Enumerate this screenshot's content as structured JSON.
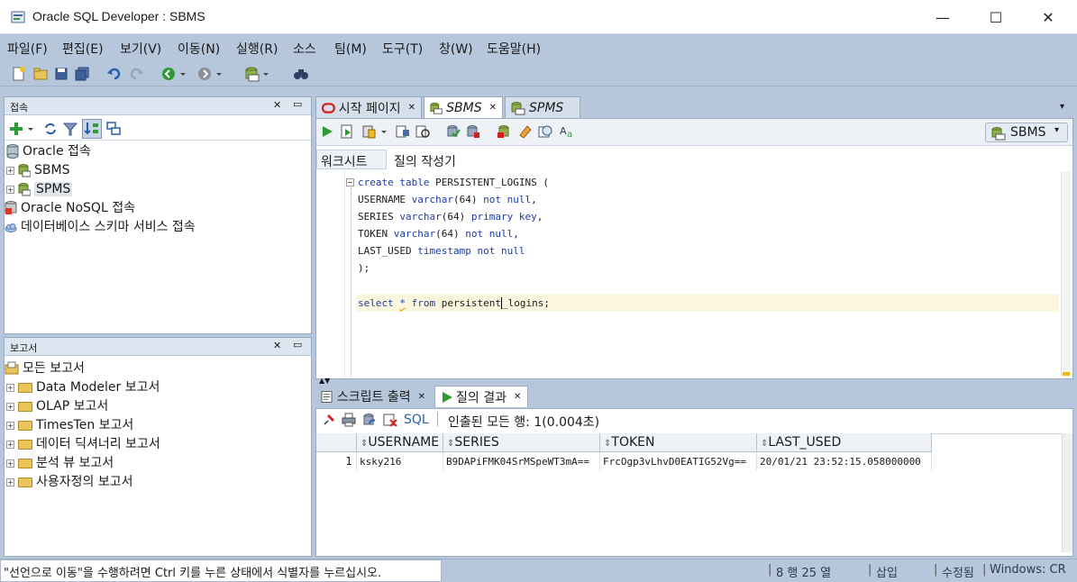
{
  "window": {
    "title": "Oracle SQL Developer : SBMS",
    "minimize": "—",
    "maximize": "☐",
    "close": "✕"
  },
  "menu": [
    "파일(F)",
    "편집(E)",
    "보기(V)",
    "이동(N)",
    "실행(R)",
    "소스",
    "팀(M)",
    "도구(T)",
    "창(W)",
    "도움말(H)"
  ],
  "connections_panel": {
    "title": "접속",
    "items": [
      {
        "label": "Oracle 접속"
      },
      {
        "label": "SBMS"
      },
      {
        "label": "SPMS"
      },
      {
        "label": "Oracle NoSQL 접속"
      },
      {
        "label": "데이터베이스 스키마 서비스 접속"
      }
    ]
  },
  "reports_panel": {
    "title": "보고서",
    "items": [
      {
        "label": "모든 보고서"
      },
      {
        "label": "Data Modeler 보고서"
      },
      {
        "label": "OLAP 보고서"
      },
      {
        "label": "TimesTen 보고서"
      },
      {
        "label": "데이터 딕셔너리 보고서"
      },
      {
        "label": "분석 뷰 보고서"
      },
      {
        "label": "사용자정의 보고서"
      }
    ]
  },
  "editor_tabs": [
    {
      "label": "시작 페이지"
    },
    {
      "label": "SBMS"
    },
    {
      "label": "SPMS"
    }
  ],
  "connection_selector": "SBMS",
  "sub_tabs": [
    "워크시트",
    "질의 작성기"
  ],
  "code_lines": [
    "create table PERSISTENT_LOGINS (",
    "USERNAME varchar(64) not null,",
    "SERIES varchar(64) primary key,",
    "TOKEN varchar(64) not null,",
    "LAST_USED timestamp not null",
    ");",
    "",
    "select * from persistent_logins;"
  ],
  "result_tabs": [
    "스크립트 출력",
    "질의 결과"
  ],
  "result_toolbar": {
    "sql_label": "SQL",
    "status": "인출된 모든 행: 1(0.004초)"
  },
  "result_grid": {
    "columns": [
      "USERNAME",
      "SERIES",
      "TOKEN",
      "LAST_USED"
    ],
    "rows": [
      {
        "num": "1",
        "cells": [
          "ksky216",
          "B9DAPiFMK04SrMSpeWT3mA==",
          "FrcOgp3vLhvD0EATIG52Vg==",
          "20/01/21 23:52:15.058000000"
        ]
      }
    ]
  },
  "status_bar": {
    "message": "\"선언으로 이동\"을 수행하려면 Ctrl 키를 누른 상태에서 식별자를 누르십시오.",
    "position": "8 행 25 열",
    "mode": "삽입",
    "modified": "수정됨",
    "os": "Windows: CR"
  }
}
